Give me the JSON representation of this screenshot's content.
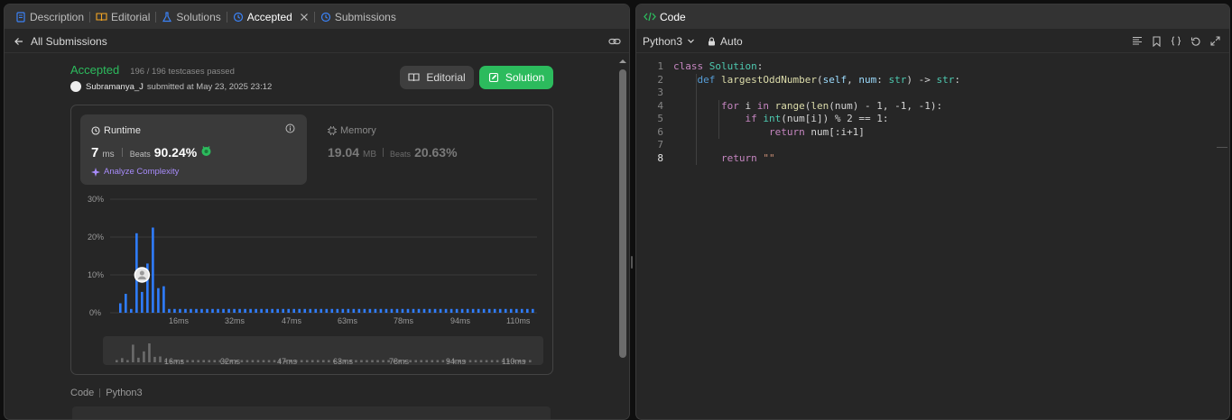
{
  "tabs": [
    {
      "label": "Description",
      "icon": "description-icon"
    },
    {
      "label": "Editorial",
      "icon": "book-icon"
    },
    {
      "label": "Solutions",
      "icon": "flask-icon"
    },
    {
      "label": "Accepted",
      "icon": "history-icon",
      "active": true
    },
    {
      "label": "Submissions",
      "icon": "history-icon"
    }
  ],
  "subbar": {
    "back_label": "All Submissions"
  },
  "result": {
    "status": "Accepted",
    "testcases": "196 / 196 testcases passed",
    "username": "Subramanya_J",
    "submitted": "submitted at May 23, 2025 23:12",
    "editorial_button": "Editorial",
    "solution_button": "Solution"
  },
  "runtime": {
    "title": "Runtime",
    "value": "7",
    "unit": "ms",
    "beats_label": "Beats",
    "beats": "90.24%",
    "analyze": "Analyze Complexity"
  },
  "memory": {
    "title": "Memory",
    "value": "19.04",
    "unit": "MB",
    "beats_label": "Beats",
    "beats": "20.63%"
  },
  "chart_data": {
    "type": "bar",
    "yticks": [
      "30%",
      "20%",
      "10%",
      "0%"
    ],
    "ylim": [
      0,
      30
    ],
    "xticks": [
      "16ms",
      "32ms",
      "47ms",
      "63ms",
      "78ms",
      "94ms",
      "110ms"
    ],
    "values": [
      2.5,
      5,
      1,
      21,
      5.5,
      13,
      22.5,
      6.5,
      7,
      1,
      1,
      1,
      1,
      1,
      1,
      1,
      1,
      1,
      1,
      1,
      1,
      1,
      1,
      1,
      1,
      1,
      1,
      1,
      1,
      1,
      1,
      1,
      1,
      1,
      1,
      1,
      1,
      1,
      1,
      1,
      1,
      1,
      1,
      1,
      1,
      1,
      1,
      1,
      1,
      1,
      1,
      1,
      1,
      1,
      1,
      1,
      1,
      1,
      1,
      1,
      1,
      1,
      1,
      1,
      1,
      1,
      1,
      1,
      1,
      1,
      1,
      1,
      1,
      1,
      1,
      1,
      1
    ],
    "highlight_index": 4,
    "grid": true,
    "colors": {
      "bar": "#2f7dff",
      "grid": "#3a3a3a",
      "mini": "#6b6b6b"
    }
  },
  "code_section": {
    "label": "Code",
    "language": "Python3"
  },
  "editor": {
    "title": "Code",
    "language": "Python3",
    "mode": "Auto",
    "lines": [
      [
        {
          "t": "class ",
          "c": "#c586c0"
        },
        {
          "t": "Solution",
          "c": "#4ec9b0"
        },
        {
          "t": ":",
          "c": "#d4d4d4"
        }
      ],
      [
        {
          "t": "    ",
          "c": "#d4d4d4"
        },
        {
          "t": "def ",
          "c": "#569cd6"
        },
        {
          "t": "largestOddNumber",
          "c": "#dcdcaa"
        },
        {
          "t": "(",
          "c": "#d4d4d4"
        },
        {
          "t": "self",
          "c": "#9cdcfe"
        },
        {
          "t": ", ",
          "c": "#d4d4d4"
        },
        {
          "t": "num",
          "c": "#9cdcfe"
        },
        {
          "t": ": ",
          "c": "#d4d4d4"
        },
        {
          "t": "str",
          "c": "#4ec9b0"
        },
        {
          "t": ") -> ",
          "c": "#d4d4d4"
        },
        {
          "t": "str",
          "c": "#4ec9b0"
        },
        {
          "t": ":",
          "c": "#d4d4d4"
        }
      ],
      [],
      [
        {
          "t": "        ",
          "c": "#d4d4d4"
        },
        {
          "t": "for ",
          "c": "#c586c0"
        },
        {
          "t": "i ",
          "c": "#d4d4d4"
        },
        {
          "t": "in ",
          "c": "#c586c0"
        },
        {
          "t": "range",
          "c": "#dcdcaa"
        },
        {
          "t": "(",
          "c": "#d4d4d4"
        },
        {
          "t": "len",
          "c": "#dcdcaa"
        },
        {
          "t": "(num) - 1, -1, -1):",
          "c": "#d4d4d4"
        }
      ],
      [
        {
          "t": "            ",
          "c": "#d4d4d4"
        },
        {
          "t": "if ",
          "c": "#c586c0"
        },
        {
          "t": "int",
          "c": "#4ec9b0"
        },
        {
          "t": "(num[i]) % 2 == 1:",
          "c": "#d4d4d4"
        }
      ],
      [
        {
          "t": "                ",
          "c": "#d4d4d4"
        },
        {
          "t": "return ",
          "c": "#c586c0"
        },
        {
          "t": "num[:i+1]",
          "c": "#d4d4d4"
        }
      ],
      [],
      [
        {
          "t": "        ",
          "c": "#d4d4d4"
        },
        {
          "t": "return ",
          "c": "#c586c0"
        },
        {
          "t": "\"\"",
          "c": "#ce9178"
        }
      ]
    ]
  }
}
